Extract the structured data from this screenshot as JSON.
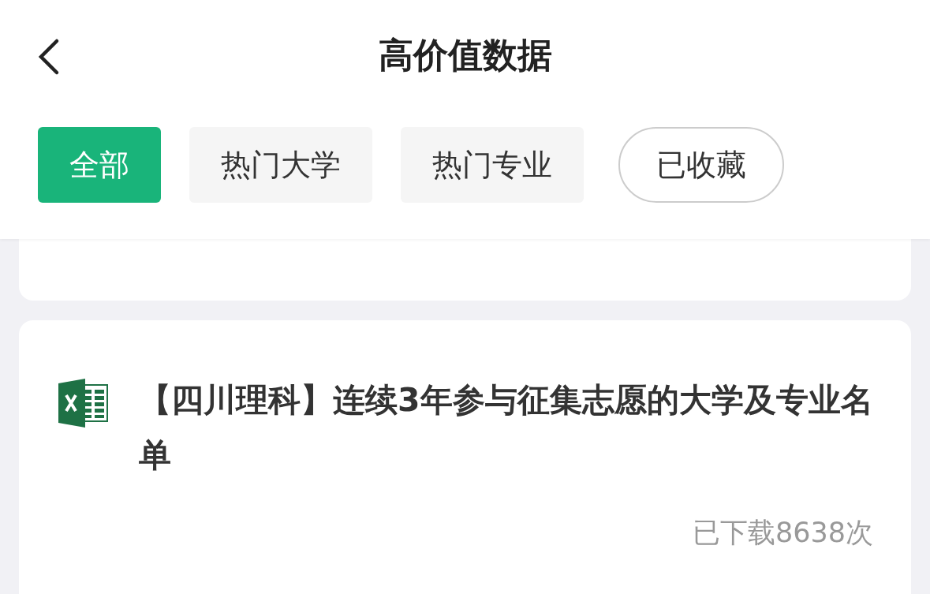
{
  "header": {
    "title": "高价值数据"
  },
  "tabs": [
    {
      "label": "全部",
      "selected": true,
      "kind": "filter"
    },
    {
      "label": "热门大学",
      "selected": false,
      "kind": "filter"
    },
    {
      "label": "热门专业",
      "selected": false,
      "kind": "filter"
    },
    {
      "label": "已收藏",
      "selected": false,
      "kind": "pill"
    }
  ],
  "cards": [
    {
      "kind": "partial"
    },
    {
      "kind": "excel",
      "title": "【四川理科】连续3年参与征集志愿的大学及专业名单",
      "downloads": "已下载8638次"
    }
  ]
}
